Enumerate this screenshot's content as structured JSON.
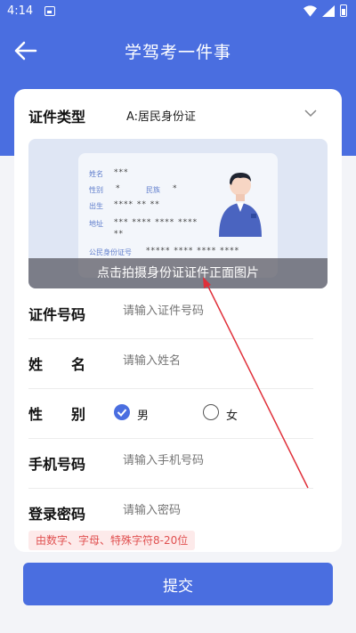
{
  "status_bar": {
    "time": "4:14"
  },
  "app_bar": {
    "title": "学驾考一件事",
    "back_icon": "arrow-left-icon"
  },
  "form": {
    "id_type": {
      "label": "证件类型",
      "value": "A:居民身份证"
    },
    "id_card_preview": {
      "name_label": "姓名",
      "name_value": "***",
      "gender_label": "性别",
      "gender_value": "*",
      "ethnicity_label": "民族",
      "ethnicity_value": "*",
      "birth_label": "出生",
      "birth_value": "****  **  **",
      "address_label": "地址",
      "address_value_1": "***  ****  ****  ****",
      "address_value_2": "**",
      "idnum_label": "公民身份证号",
      "idnum_value": "*****  ****  ****  ****",
      "hint": "点击拍摄身份证证件正面图片"
    },
    "id_number": {
      "label": "证件号码",
      "placeholder": "请输入证件号码"
    },
    "name": {
      "label": "姓　　名",
      "placeholder": "请输入姓名"
    },
    "gender": {
      "label": "性　　别",
      "options": [
        "男",
        "女"
      ],
      "selected": "男"
    },
    "phone": {
      "label": "手机号码",
      "placeholder": "请输入手机号码"
    },
    "password": {
      "label": "登录密码",
      "placeholder": "请输入密码",
      "hint": "由数字、字母、特殊字符8-20位"
    }
  },
  "submit_label": "提交",
  "colors": {
    "primary": "#4a6ee0",
    "annotation_arrow": "#e0303a"
  }
}
